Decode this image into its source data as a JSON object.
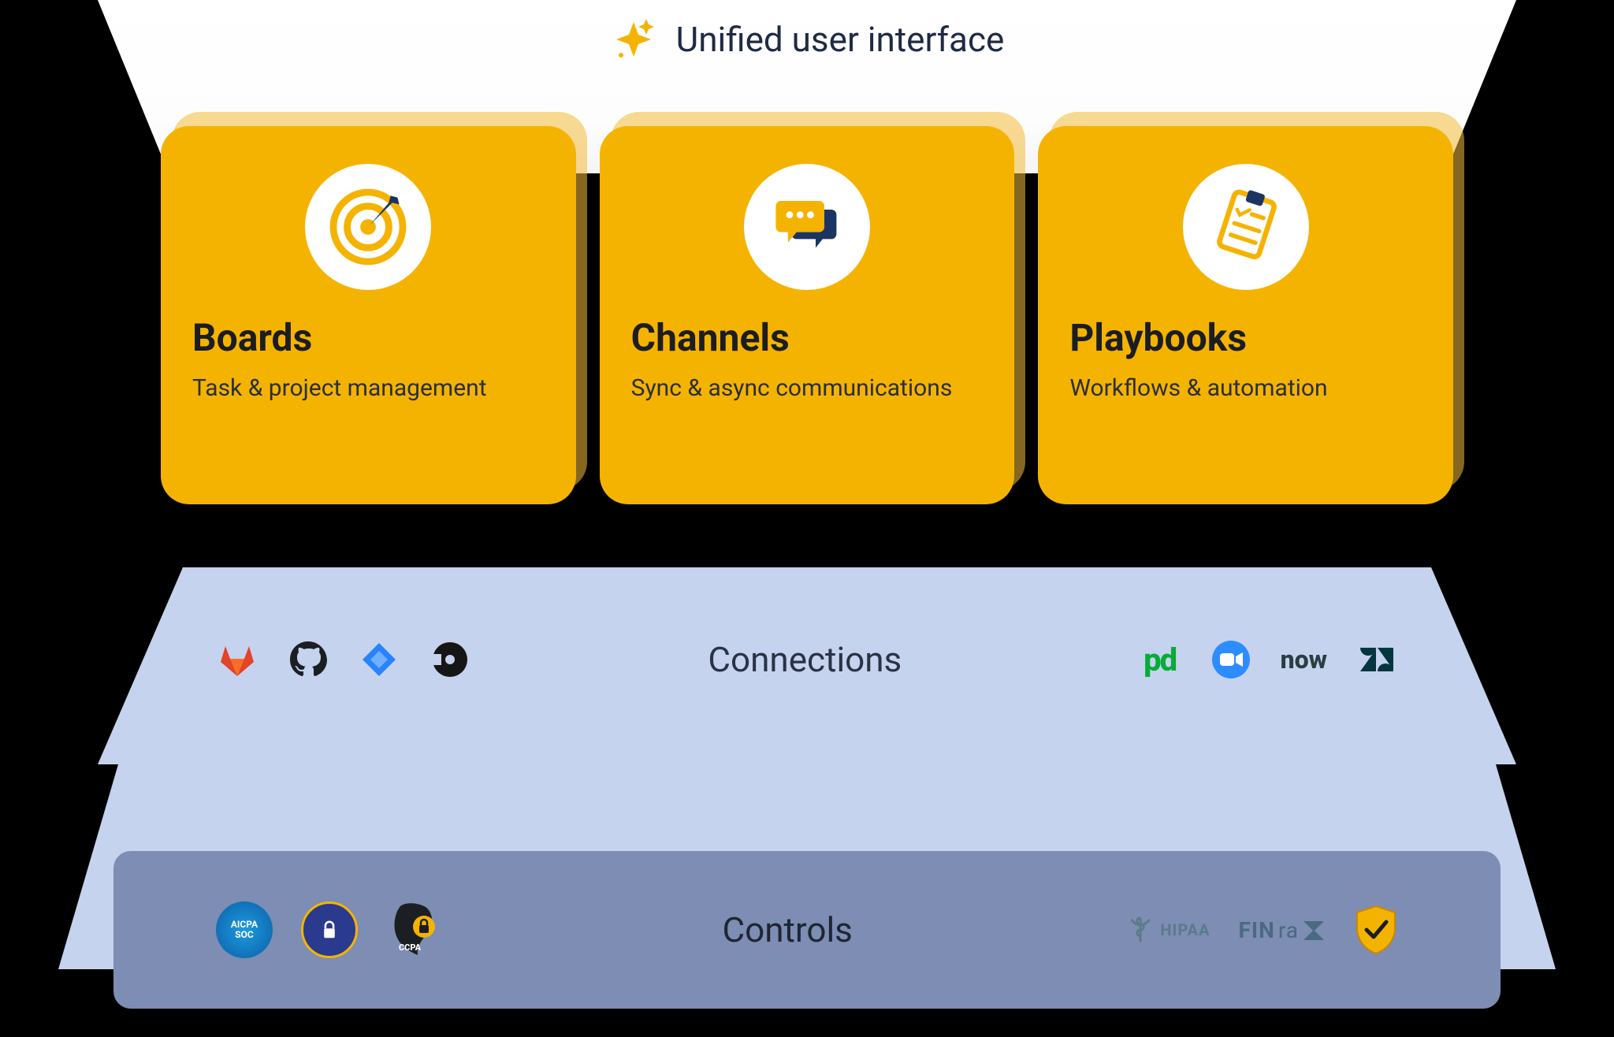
{
  "banner": {
    "title": "Unified user interface"
  },
  "cards": [
    {
      "title": "Boards",
      "subtitle": "Task & project management",
      "icon": "target"
    },
    {
      "title": "Channels",
      "subtitle": "Sync & async communications",
      "icon": "chat"
    },
    {
      "title": "Playbooks",
      "subtitle": "Workflows & automation",
      "icon": "clipboard"
    }
  ],
  "connections": {
    "title": "Connections",
    "left_logos": [
      "gitlab",
      "github",
      "jira",
      "circleci"
    ],
    "right_logos": [
      "pagerduty",
      "zoom",
      "servicenow",
      "zendesk"
    ]
  },
  "controls": {
    "title": "Controls",
    "left_badges": [
      "aicpa-soc",
      "gdpr",
      "ccpa"
    ],
    "right_badges": [
      "hipaa",
      "finra",
      "security-shield"
    ]
  },
  "labels": {
    "aicpa": "AICPA",
    "soc": "SOC",
    "ccpa": "CCPA",
    "hipaa": "HIPAA",
    "finra": "FIN",
    "finra2": "ra",
    "pd": "pd",
    "now": "now"
  },
  "colors": {
    "accent": "#f5b301",
    "navy": "#1c3461"
  }
}
